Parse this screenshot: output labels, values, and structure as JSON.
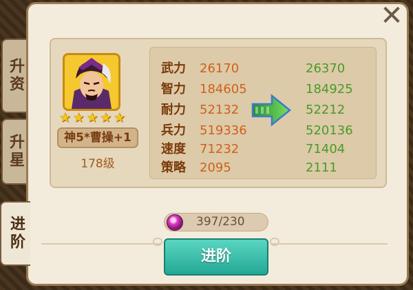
{
  "tabs": [
    {
      "label": "升资",
      "active": false
    },
    {
      "label": "升星",
      "active": false
    },
    {
      "label": "进阶",
      "active": true
    }
  ],
  "close_icon": "close-x-icon",
  "hero": {
    "name": "神5*曹操+1",
    "level": "178级",
    "stars": 5,
    "portrait_icon": "hero-portrait"
  },
  "stats": [
    {
      "label": "武力",
      "current": "26170",
      "next": "26370"
    },
    {
      "label": "智力",
      "current": "184605",
      "next": "184925"
    },
    {
      "label": "耐力",
      "current": "52132",
      "next": "52212"
    },
    {
      "label": "兵力",
      "current": "519336",
      "next": "520136"
    },
    {
      "label": "速度",
      "current": "71232",
      "next": "71404"
    },
    {
      "label": "策略",
      "current": "2095",
      "next": "2111"
    }
  ],
  "arrow_icon": "green-arrow-right-icon",
  "material": {
    "icon": "purple-gem-icon",
    "text": "397/230"
  },
  "advance_button": {
    "label": "进阶"
  },
  "colors": {
    "panel": "#f3ecdd",
    "stat_label": "#7a3a0a",
    "stat_current": "#d0601c",
    "stat_next": "#4a9a28",
    "button": "#2fb8a4"
  }
}
